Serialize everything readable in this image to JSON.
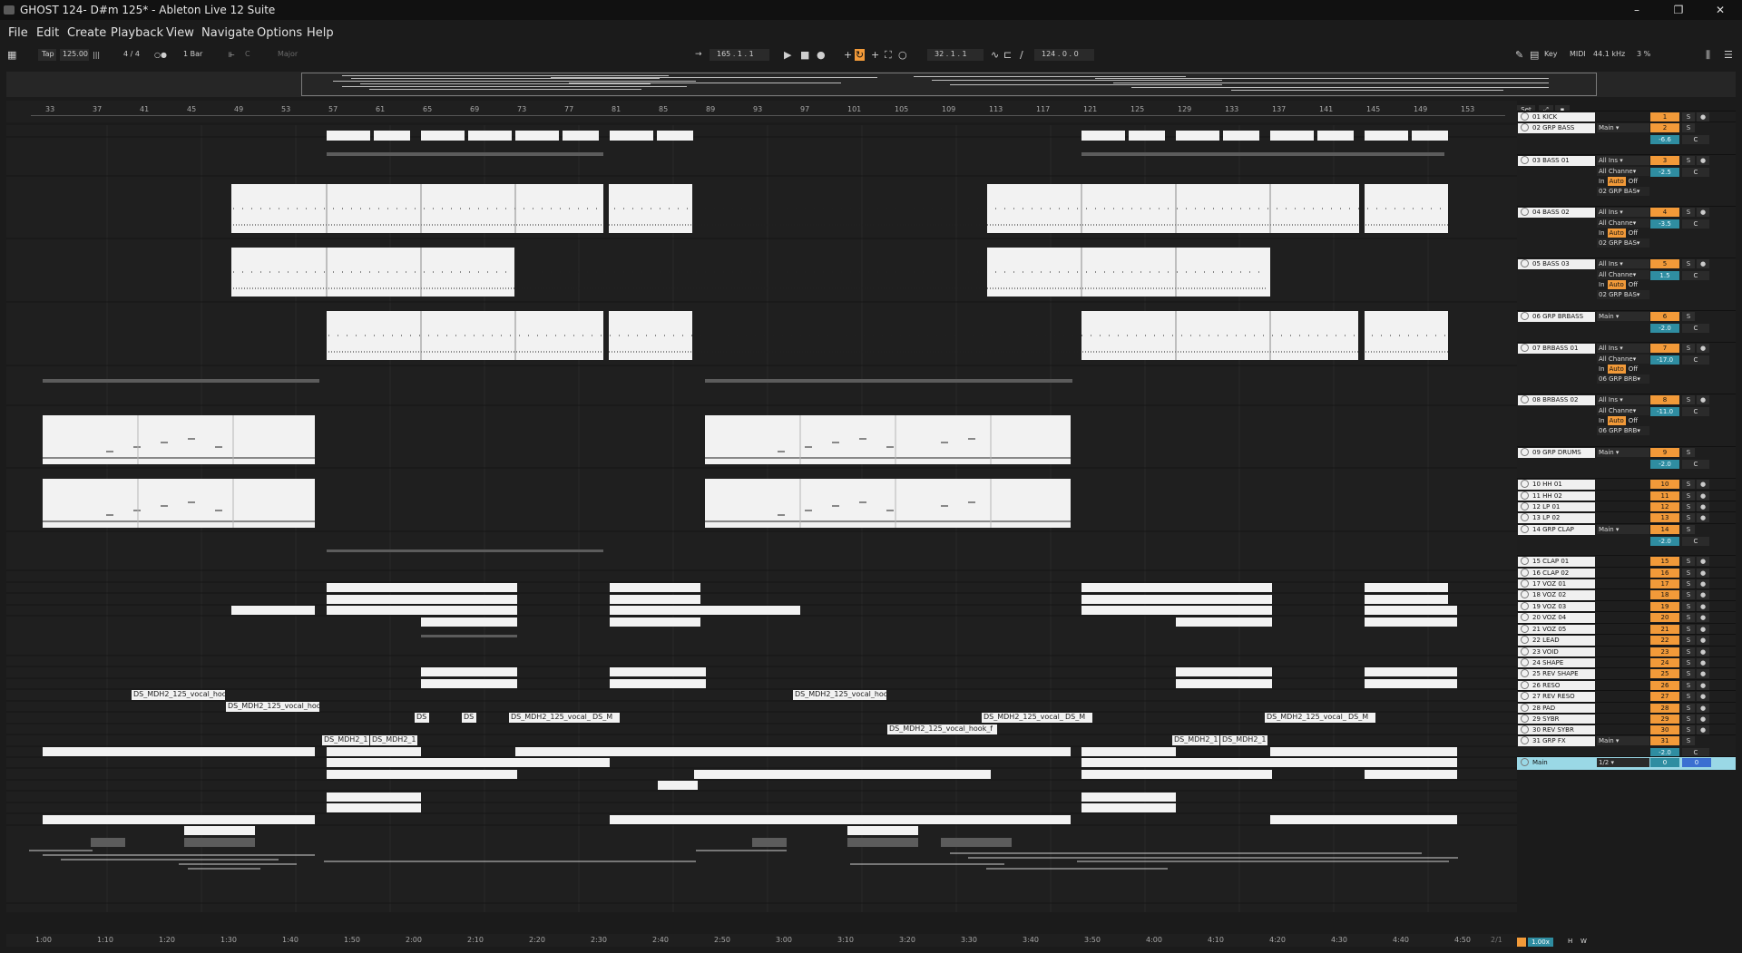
{
  "window": {
    "title": "GHOST 124- D#m 125* - Ableton Live 12 Suite",
    "minimize": "–",
    "maximize": "❐",
    "close": "✕"
  },
  "menu": [
    "File",
    "Edit",
    "Create",
    "Playback",
    "View",
    "Navigate",
    "Options",
    "Help"
  ],
  "control_bar": {
    "tap": "Tap",
    "tempo": "125.00",
    "time_sig": "4 / 4",
    "quantize": "1 Bar",
    "key_root": "C",
    "scale": "Major",
    "arrangement_position": "165 .  1 .  1",
    "loop_start": "32 .  1 .  1",
    "loop_length": "124 .  0 .  0",
    "key_label": "Key",
    "midi_label": "MIDI",
    "sample_rate": "44.1 kHz",
    "cpu": "3 %"
  },
  "ruler_bars": [
    "33",
    "37",
    "41",
    "45",
    "49",
    "53",
    "57",
    "61",
    "65",
    "69",
    "73",
    "77",
    "81",
    "85",
    "89",
    "93",
    "97",
    "101",
    "105",
    "109",
    "113",
    "117",
    "121",
    "125",
    "129",
    "133",
    "137",
    "141",
    "145",
    "149",
    "153"
  ],
  "time_ticks": [
    "1:00",
    "1:10",
    "1:20",
    "1:30",
    "1:40",
    "1:50",
    "2:00",
    "2:10",
    "2:20",
    "2:30",
    "2:40",
    "2:50",
    "3:00",
    "3:10",
    "3:20",
    "3:30",
    "3:40",
    "3:50",
    "4:00",
    "4:10",
    "4:20",
    "4:30",
    "4:40",
    "4:50"
  ],
  "mixer_header": {
    "set_label": "Set"
  },
  "tracks": [
    {
      "name": "01 KICK",
      "num": "1"
    },
    {
      "name": "02 GRP BASS",
      "num": "2",
      "group": true,
      "output": "Main",
      "vol": "-6.6",
      "pan": "C"
    },
    {
      "name": "03 BASS 01",
      "num": "3",
      "input": "All Ins",
      "channel": "All Channe",
      "output": "02 GRP BAS",
      "vol": "-2.5",
      "pan": "C"
    },
    {
      "name": "04 BASS 02",
      "num": "4",
      "input": "All Ins",
      "channel": "All Channe",
      "output": "02 GRP BAS",
      "vol": "-3.5",
      "pan": "C"
    },
    {
      "name": "05 BASS 03",
      "num": "5",
      "input": "All Ins",
      "channel": "All Channe",
      "output": "02 GRP BAS",
      "vol": "1.5",
      "pan": "C"
    },
    {
      "name": "06 GRP BRBASS",
      "num": "6",
      "group": true,
      "output": "Main",
      "vol": "-2.0",
      "pan": "C"
    },
    {
      "name": "07 BRBASS 01",
      "num": "7",
      "input": "All Ins",
      "channel": "All Channe",
      "output": "06 GRP BRB",
      "vol": "-17.0",
      "pan": "C"
    },
    {
      "name": "08 BRBASS 02",
      "num": "8",
      "input": "All Ins",
      "channel": "All Channe",
      "output": "06 GRP BRB",
      "vol": "-11.0",
      "pan": "C"
    },
    {
      "name": "09 GRP DRUMS",
      "num": "9",
      "group": true,
      "output": "Main",
      "vol": "-2.0",
      "pan": "C"
    },
    {
      "name": "10 HH 01",
      "num": "10"
    },
    {
      "name": "11 HH 02",
      "num": "11"
    },
    {
      "name": "12 LP 01",
      "num": "12"
    },
    {
      "name": "13 LP 02",
      "num": "13"
    },
    {
      "name": "14 GRP CLAP",
      "num": "14",
      "group": true,
      "output": "Main",
      "vol": "-2.0",
      "pan": "C"
    },
    {
      "name": "15 CLAP 01",
      "num": "15"
    },
    {
      "name": "16 CLAP 02",
      "num": "16"
    },
    {
      "name": "17 VOZ 01",
      "num": "17"
    },
    {
      "name": "18 VOZ 02",
      "num": "18"
    },
    {
      "name": "19 VOZ 03",
      "num": "19"
    },
    {
      "name": "20 VOZ 04",
      "num": "20"
    },
    {
      "name": "21 VOZ 05",
      "num": "21"
    },
    {
      "name": "22 LEAD",
      "num": "22"
    },
    {
      "name": "23 VOID",
      "num": "23"
    },
    {
      "name": "24 SHAPE",
      "num": "24"
    },
    {
      "name": "25 REV SHAPE",
      "num": "25"
    },
    {
      "name": "26 RESO",
      "num": "26"
    },
    {
      "name": "27 REV RESO",
      "num": "27"
    },
    {
      "name": "28 PAD",
      "num": "28"
    },
    {
      "name": "29 SYBR",
      "num": "29"
    },
    {
      "name": "30 REV SYBR",
      "num": "30"
    },
    {
      "name": "31 GRP FX",
      "num": "31",
      "group": true,
      "output": "Main",
      "vol": "-2.0",
      "pan": "C"
    },
    {
      "name": "Main",
      "num": "0",
      "master": true,
      "output": "1/2",
      "vol": "0"
    }
  ],
  "labels": {
    "in": "In",
    "auto": "Auto",
    "off": "Off",
    "solo": "S",
    "pan_center": "C"
  },
  "clip_texts": {
    "vocal_hook_1": "DS_MDH2_125_vocal_hoo",
    "vocal_hook_2": "DS_MDH2_125_vocal_hoo",
    "vocal_hook_3": "DS_MDH2_125_vocal_hoo",
    "ds_short_1": "DS",
    "ds_short_2": "DS",
    "vocal_a": "DS_MDH2_125_vocal_",
    "ds_m_1": "DS_M",
    "vocal_hook_f": "DS_MDH2_125_vocal_hook_f",
    "vocal_b": "DS_MDH2_125_vocal_",
    "ds_m_2": "DS_M",
    "vocal_c": "DS_MDH2_125_vocal_",
    "ds_m_3": "DS_M",
    "voz05_1": "DS_MDH2_1",
    "voz05_2": "DS_MDH2_1",
    "voz05_3": "DS_MDH2_1",
    "voz05_4": "DS_MDH2_1"
  },
  "bottom": {
    "page": "2/1",
    "zoom": "1.00x",
    "h": "H",
    "w": "W"
  }
}
